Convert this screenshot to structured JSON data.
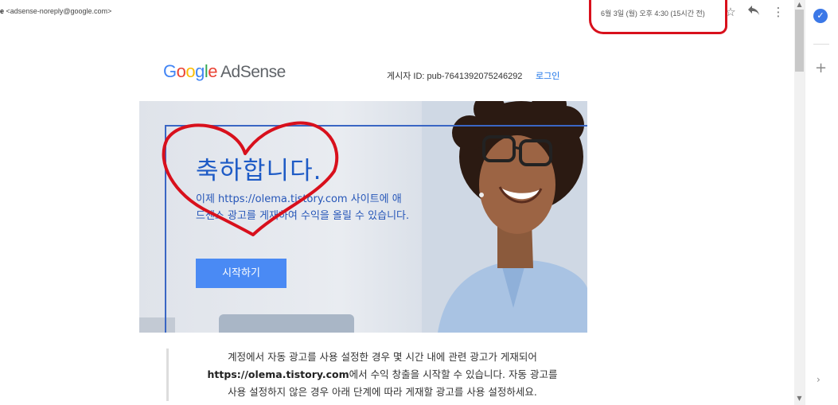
{
  "email": {
    "sender_name_fragment": "e",
    "sender_email": "<adsense-noreply@google.com>",
    "date": "6월 3일 (월) 오후 4:30 (15시간 전)"
  },
  "header_icons": [
    "star-icon",
    "reply-icon",
    "more-vert-icon"
  ],
  "adsense": {
    "logo_google": [
      "G",
      "o",
      "o",
      "g",
      "l",
      "e"
    ],
    "logo_product": "AdSense",
    "publisher_id": "게시자 ID: pub-7641392075246292",
    "login_label": "로그인"
  },
  "hero": {
    "title": "축하합니다.",
    "message": "이제 https://olema.tistory.com 사이트에 애드센스 광고를 게재하여 수익을 올릴 수 있습니다.",
    "cta_label": "시작하기"
  },
  "body": {
    "line1": "계정에서 자동 광고를 사용 설정한 경우 몇 시간 내에 관련 광고가 게재되어",
    "line2_bold": "https://olema.tistory.com",
    "line2_rest": "에서 수익 창출을 시작할 수 있습니다. 자동 광고를",
    "line3": "사용 설정하지 않은 경우 아래 단계에 따라 게재할 광고를 사용 설정하세요."
  },
  "colors": {
    "annotation_red": "#d8101c",
    "brand_blue": "#1e5bc6",
    "cta_blue": "#4a8af4",
    "link_blue": "#1a73e8"
  }
}
